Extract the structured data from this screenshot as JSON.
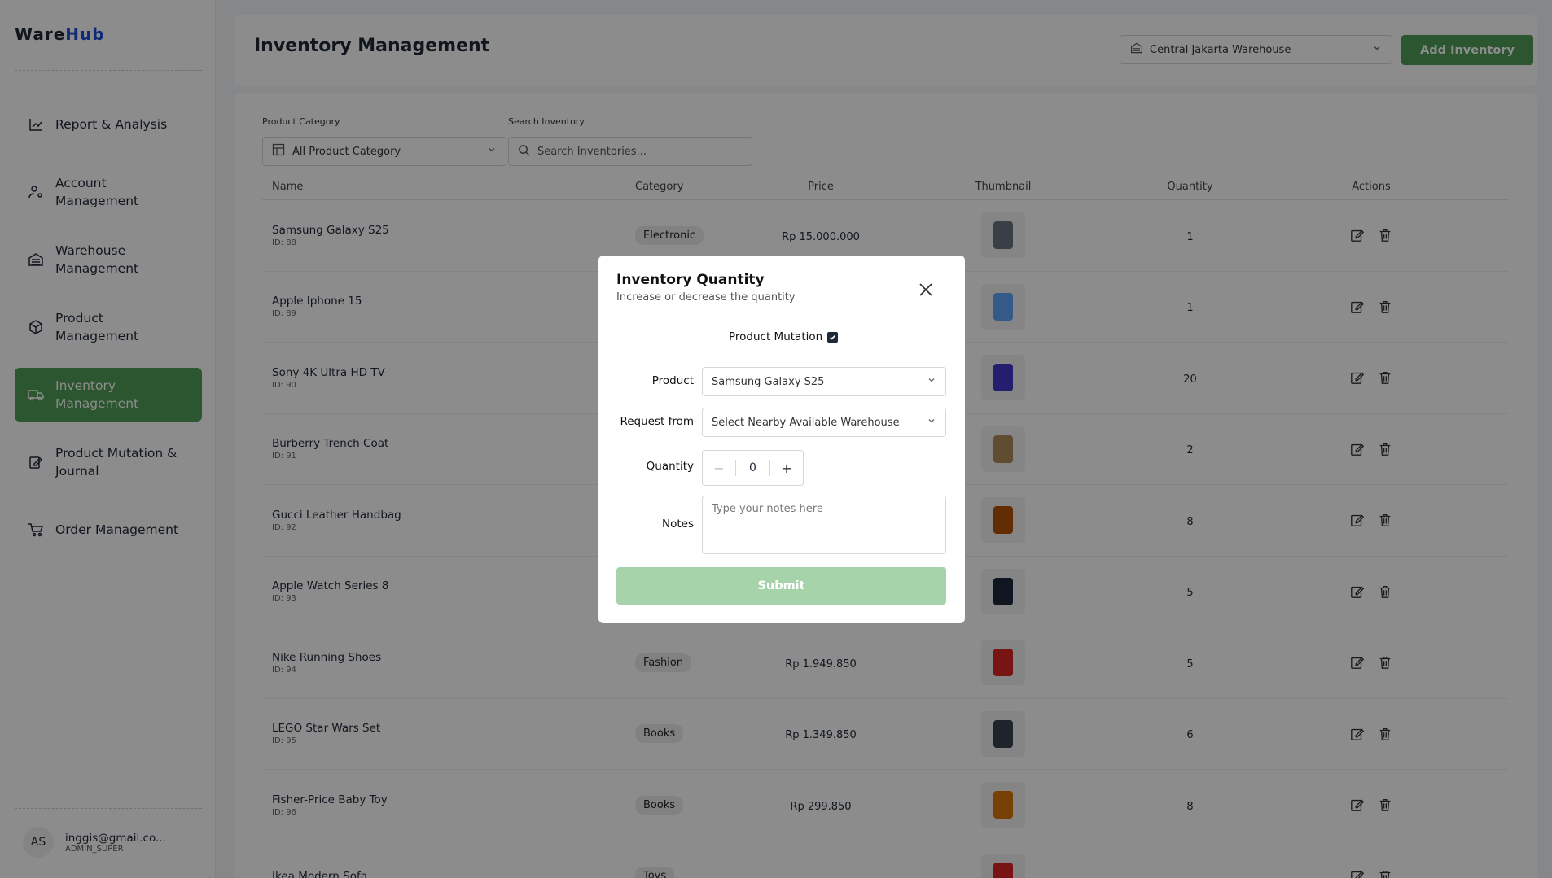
{
  "app": {
    "logo_part1": "Ware",
    "logo_part2": "Hub"
  },
  "sidebar": {
    "items": [
      {
        "label": "Report & Analysis",
        "icon": "chart-line-icon"
      },
      {
        "label": "Account Management",
        "icon": "user-cog-icon"
      },
      {
        "label": "Warehouse Management",
        "icon": "warehouse-icon"
      },
      {
        "label": "Product Management",
        "icon": "package-icon"
      },
      {
        "label": "Inventory Management",
        "icon": "truck-icon",
        "active": true
      },
      {
        "label": "Product Mutation & Journal",
        "icon": "edit-note-icon"
      },
      {
        "label": "Order Management",
        "icon": "cart-icon"
      }
    ],
    "user": {
      "initials": "AS",
      "email": "inggis@gmail.co...",
      "role": "ADMIN_SUPER"
    }
  },
  "header": {
    "title": "Inventory Management",
    "warehouse": "Central Jakarta Warehouse",
    "add_label": "Add Inventory"
  },
  "filters": {
    "category_label": "Product Category",
    "category_value": "All Product Category",
    "search_label": "Search Inventory",
    "search_placeholder": "Search Inventories..."
  },
  "table": {
    "columns": [
      "Name",
      "Category",
      "Price",
      "Thumbnail",
      "Quantity",
      "Actions"
    ],
    "rows": [
      {
        "name": "Samsung Galaxy S25",
        "id": "ID: 88",
        "category": "Electronic",
        "price": "Rp 15.000.000",
        "qty": "1",
        "thumb": "#6b7280"
      },
      {
        "name": "Apple Iphone 15",
        "id": "ID: 89",
        "category": "",
        "price": "",
        "qty": "1",
        "thumb": "#60a5fa"
      },
      {
        "name": "Sony 4K Ultra HD TV",
        "id": "ID: 90",
        "category": "",
        "price": "",
        "qty": "20",
        "thumb": "#4338ca"
      },
      {
        "name": "Burberry Trench Coat",
        "id": "ID: 91",
        "category": "",
        "price": "",
        "qty": "2",
        "thumb": "#b08a5a"
      },
      {
        "name": "Gucci Leather Handbag",
        "id": "ID: 92",
        "category": "",
        "price": "",
        "qty": "8",
        "thumb": "#b45309"
      },
      {
        "name": "Apple Watch Series 8",
        "id": "ID: 93",
        "category": "",
        "price": "",
        "qty": "5",
        "thumb": "#1e293b"
      },
      {
        "name": "Nike Running Shoes",
        "id": "ID: 94",
        "category": "Fashion",
        "price": "Rp 1.949.850",
        "qty": "5",
        "thumb": "#dc2626"
      },
      {
        "name": "LEGO Star Wars Set",
        "id": "ID: 95",
        "category": "Books",
        "price": "Rp 1.349.850",
        "qty": "6",
        "thumb": "#374151"
      },
      {
        "name": "Fisher-Price Baby Toy",
        "id": "ID: 96",
        "category": "Books",
        "price": "Rp 299.850",
        "qty": "8",
        "thumb": "#d97706"
      },
      {
        "name": "Ikea Modern Sofa",
        "id": "",
        "category": "Toys",
        "price": "",
        "qty": "",
        "thumb": "#dc2626"
      }
    ]
  },
  "modal": {
    "title": "Inventory Quantity",
    "subtitle": "Increase or decrease the quantity",
    "mutation_label": "Product Mutation",
    "product_label": "Product",
    "product_value": "Samsung Galaxy S25",
    "request_label": "Request from",
    "request_placeholder": "Select Nearby Available Warehouse",
    "quantity_label": "Quantity",
    "quantity_value": "0",
    "minus": "−",
    "plus": "+",
    "notes_label": "Notes",
    "notes_placeholder": "Type your notes here",
    "submit_label": "Submit"
  }
}
